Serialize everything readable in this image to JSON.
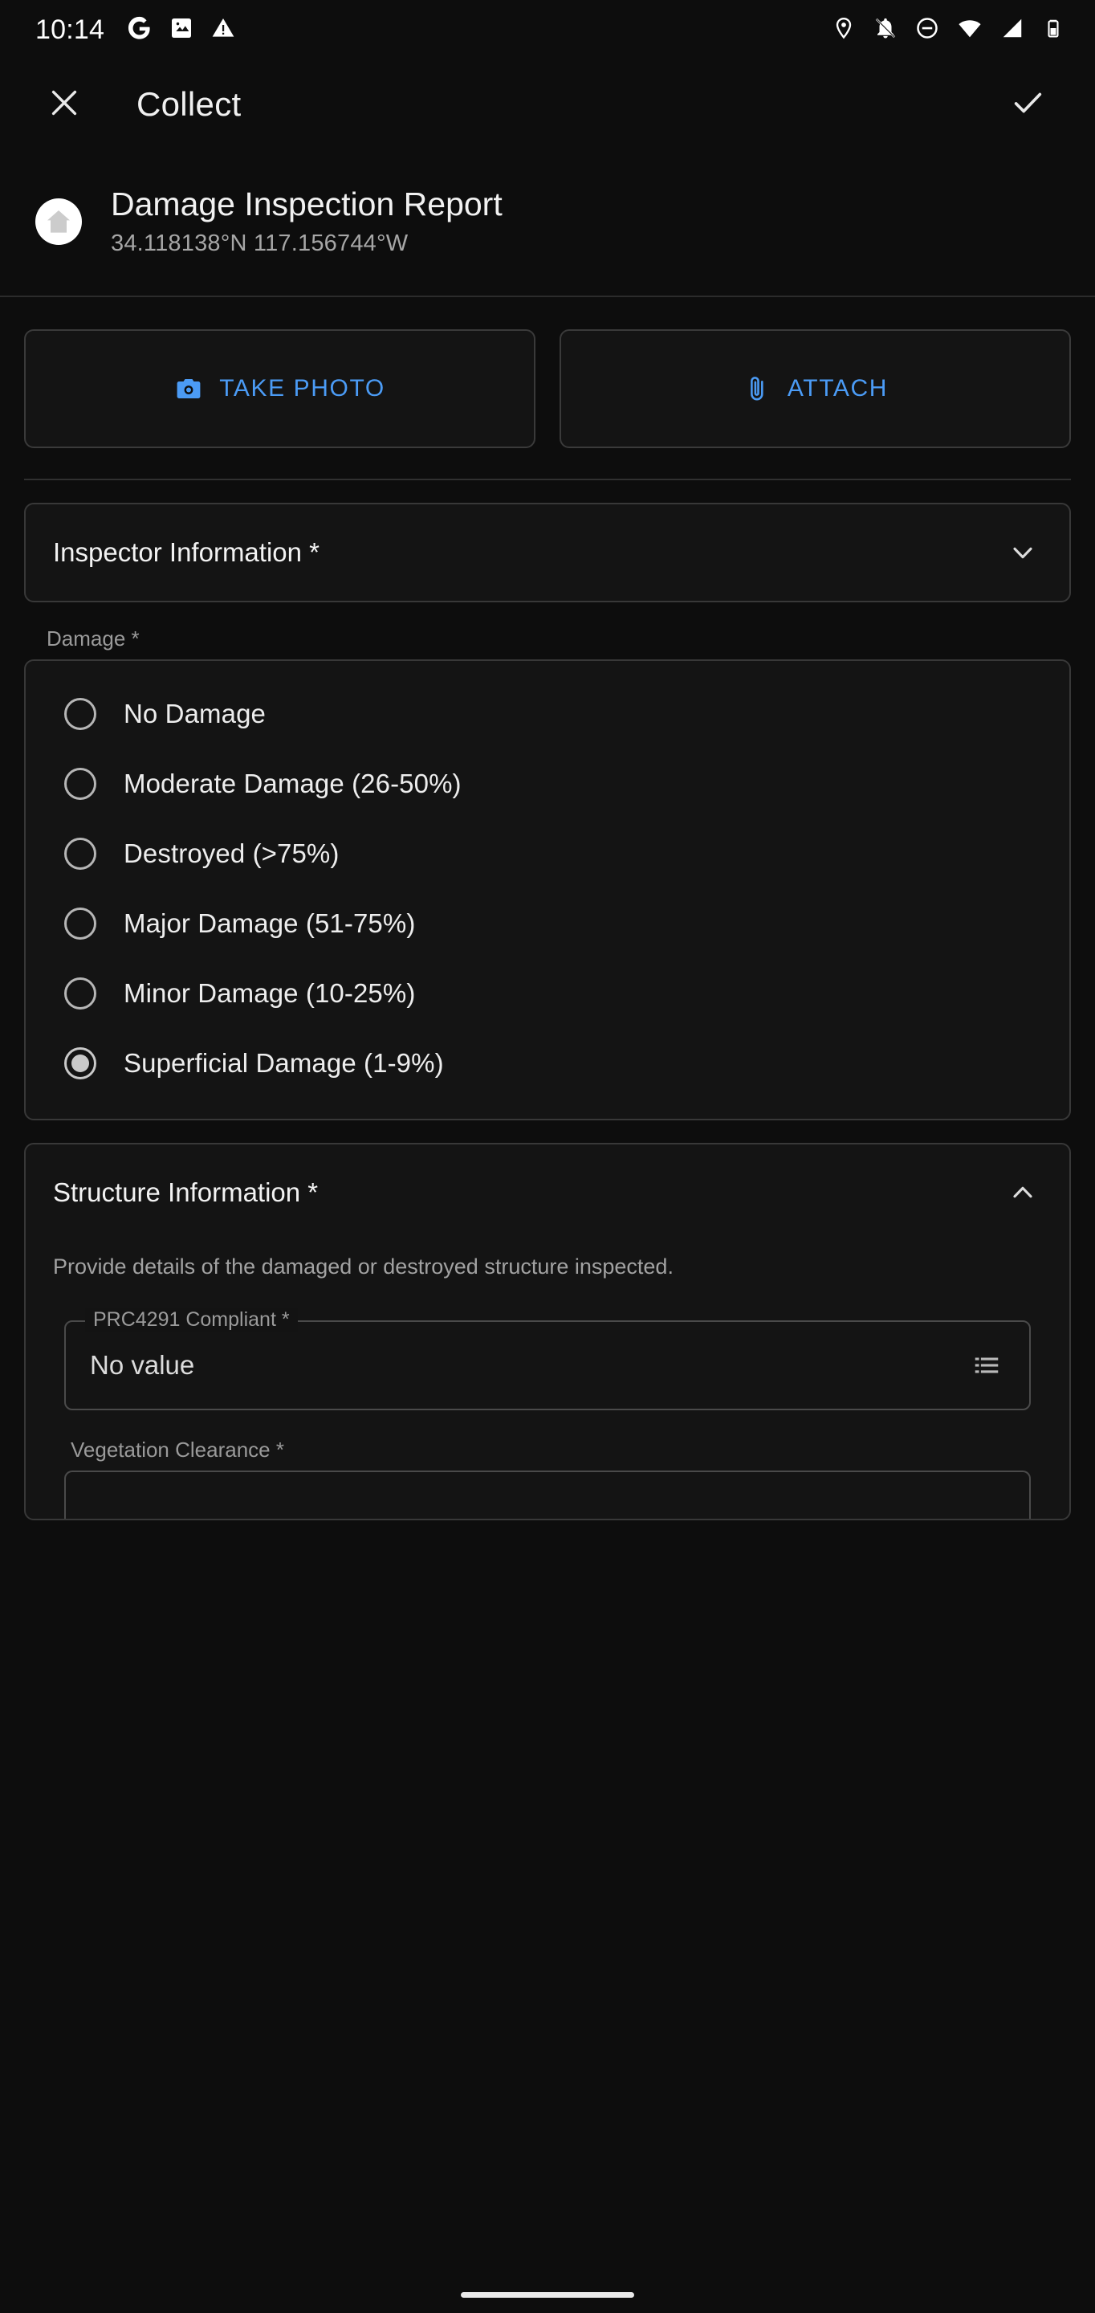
{
  "status_bar": {
    "time": "10:14",
    "left_icons": [
      "google-g-icon",
      "screenshot-icon",
      "warning-triangle-icon"
    ],
    "right_icons": [
      "location-pin-icon",
      "notifications-off-icon",
      "do-not-disturb-icon",
      "wifi-icon",
      "cellular-signal-icon",
      "battery-icon"
    ]
  },
  "app_bar": {
    "close_icon": "close-icon",
    "title": "Collect",
    "done_icon": "check-icon"
  },
  "feature_header": {
    "avatar_icon": "home-structure-icon",
    "title": "Damage Inspection Report",
    "coordinates": "34.118138°N  117.156744°W"
  },
  "attachments": {
    "take_photo_label": "TAKE PHOTO",
    "take_photo_icon": "camera-icon",
    "attach_label": "ATTACH",
    "attach_icon": "paperclip-icon"
  },
  "inspector_group": {
    "title": "Inspector Information *",
    "chevron_icon": "chevron-down-icon",
    "expanded": false
  },
  "damage_field": {
    "label": "Damage *",
    "options": [
      {
        "label": "No Damage",
        "selected": false
      },
      {
        "label": "Moderate Damage (26-50%)",
        "selected": false
      },
      {
        "label": "Destroyed (>75%)",
        "selected": false
      },
      {
        "label": "Major Damage (51-75%)",
        "selected": false
      },
      {
        "label": "Minor Damage (10-25%)",
        "selected": false
      },
      {
        "label": "Superficial Damage (1-9%)",
        "selected": true
      }
    ]
  },
  "structure_group": {
    "title": "Structure Information *",
    "chevron_icon": "chevron-up-icon",
    "description": "Provide details of the damaged or destroyed structure inspected.",
    "fields": [
      {
        "label": "PRC4291 Compliant *",
        "value": "No value",
        "trailing_icon": "list-picker-icon"
      },
      {
        "label": "Vegetation Clearance *",
        "value": "",
        "trailing_icon": "list-picker-icon"
      }
    ]
  },
  "nav_bar": {
    "home_indicator": "home-indicator"
  },
  "colors": {
    "accent": "#4b9bf5",
    "background": "#0d0d0d",
    "card": "#141414",
    "border": "#383838",
    "text_primary": "#f1f1f1",
    "text_secondary": "#9a9a9a"
  }
}
